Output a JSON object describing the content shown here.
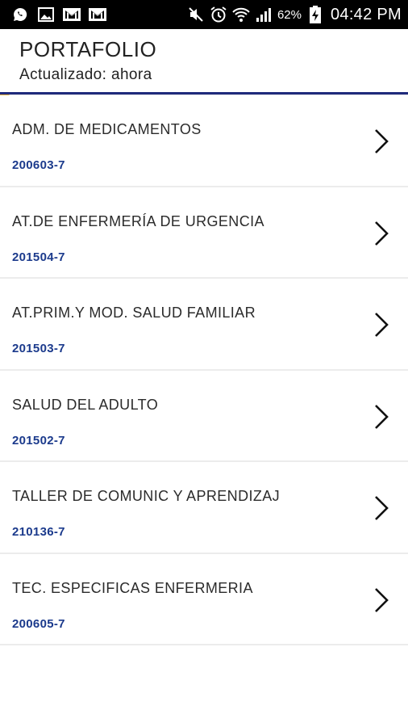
{
  "status_bar": {
    "battery_percent": "62%",
    "time": "04:42 PM",
    "left_icons": [
      "whatsapp-icon",
      "image-icon",
      "gmail-icon",
      "gmail-icon"
    ],
    "right_icons": [
      "mute-icon",
      "alarm-icon",
      "wifi-icon",
      "signal-icon",
      "battery-charging-icon"
    ]
  },
  "header": {
    "title": "PORTAFOLIO",
    "subtitle": "Actualizado: ahora"
  },
  "colors": {
    "header_rule": "#1f2a7c",
    "code_text": "#1b3a8c",
    "accent_corner": "#f0b63c"
  },
  "items": [
    {
      "name": "ADM. DE MEDICAMENTOS",
      "code": "200603-7"
    },
    {
      "name": "AT.DE ENFERMERÍA DE URGENCIA",
      "code": "201504-7"
    },
    {
      "name": "AT.PRIM.Y MOD. SALUD FAMILIAR",
      "code": "201503-7"
    },
    {
      "name": "SALUD DEL ADULTO",
      "code": "201502-7"
    },
    {
      "name": "TALLER DE COMUNIC Y APRENDIZAJ",
      "code": "210136-7"
    },
    {
      "name": "TEC. ESPECIFICAS ENFERMERIA",
      "code": "200605-7"
    }
  ]
}
